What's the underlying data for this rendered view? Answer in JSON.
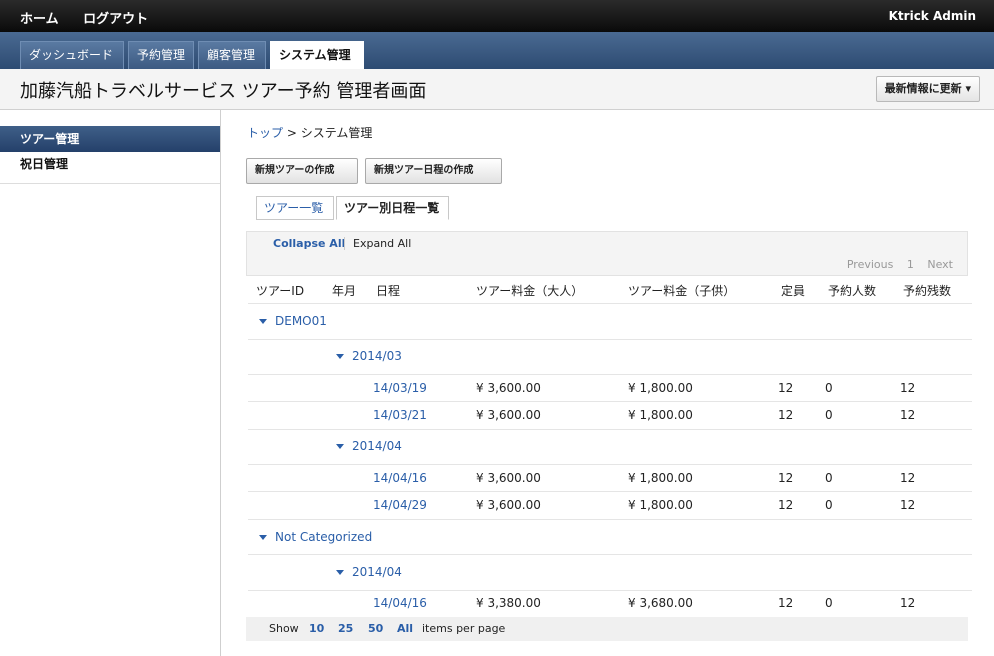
{
  "topnav": {
    "home": "ホーム",
    "logout": "ログアウト",
    "user": "Ktrick Admin"
  },
  "tabs": [
    "ダッシュボード",
    "予約管理",
    "顧客管理",
    "システム管理"
  ],
  "page": {
    "title": "加藤汽船トラベルサービス ツアー予約 管理者画面",
    "refresh": "最新情報に更新 ▾"
  },
  "sidebar": {
    "items": [
      "ツアー管理",
      "祝日管理"
    ]
  },
  "breadcrumb": {
    "home": "トップ",
    "sep": " > ",
    "current": "システム管理"
  },
  "buttons": {
    "new_tour": "新規ツアーの作成",
    "new_schedule": "新規ツアー日程の作成"
  },
  "subtabs": {
    "list": "ツアー一覧",
    "schedule": "ツアー別日程一覧"
  },
  "grid": {
    "collapse": "Collapse All",
    "expand": "Expand All",
    "pager": {
      "prev": "Previous",
      "page": "1",
      "next": "Next"
    },
    "headers": [
      "ツアーID",
      "年月",
      "日程",
      "ツアー料金（大人）",
      "ツアー料金（子供）",
      "定員",
      "予約人数",
      "予約残数"
    ],
    "groups": [
      {
        "name": "DEMO01",
        "months": [
          {
            "month": "2014/03",
            "rows": [
              {
                "date": "14/03/19",
                "adult": "¥ 3,600.00",
                "child": "¥ 1,800.00",
                "cap": "12",
                "booked": "0",
                "remain": "12"
              },
              {
                "date": "14/03/21",
                "adult": "¥ 3,600.00",
                "child": "¥ 1,800.00",
                "cap": "12",
                "booked": "0",
                "remain": "12"
              }
            ]
          },
          {
            "month": "2014/04",
            "rows": [
              {
                "date": "14/04/16",
                "adult": "¥ 3,600.00",
                "child": "¥ 1,800.00",
                "cap": "12",
                "booked": "0",
                "remain": "12"
              },
              {
                "date": "14/04/29",
                "adult": "¥ 3,600.00",
                "child": "¥ 1,800.00",
                "cap": "12",
                "booked": "0",
                "remain": "12"
              }
            ]
          }
        ]
      },
      {
        "name": "Not Categorized",
        "months": [
          {
            "month": "2014/04",
            "rows": [
              {
                "date": "14/04/16",
                "adult": "¥ 3,380.00",
                "child": "¥ 3,680.00",
                "cap": "12",
                "booked": "0",
                "remain": "12"
              }
            ]
          }
        ]
      }
    ],
    "footer": {
      "show": "Show",
      "opts": [
        "10",
        "25",
        "50",
        "All"
      ],
      "suffix": "items per page"
    }
  }
}
